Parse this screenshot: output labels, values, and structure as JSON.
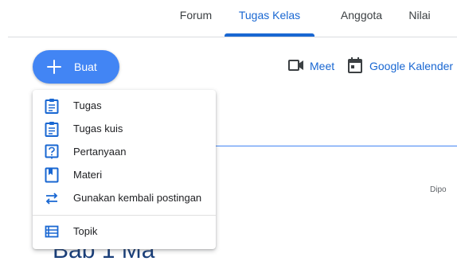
{
  "tabs": [
    {
      "label": "Forum",
      "active": false
    },
    {
      "label": "Tugas Kelas",
      "active": true
    },
    {
      "label": "Anggota",
      "active": false
    },
    {
      "label": "Nilai",
      "active": false
    }
  ],
  "create_button": {
    "label": "Buat",
    "icon": "plus-icon"
  },
  "toolbar": {
    "meet_label": "Meet",
    "calendar_label": "Google Kalender"
  },
  "menu": {
    "items": [
      {
        "label": "Tugas",
        "icon": "assignment-icon"
      },
      {
        "label": "Tugas kuis",
        "icon": "quiz-assignment-icon"
      },
      {
        "label": "Pertanyaan",
        "icon": "question-icon"
      },
      {
        "label": "Materi",
        "icon": "material-icon"
      },
      {
        "label": "Gunakan kembali postingan",
        "icon": "reuse-post-icon"
      }
    ],
    "topic": {
      "label": "Topik",
      "icon": "topic-icon"
    }
  },
  "background": {
    "partial_label": "Dipo",
    "partial_heading": "Bab 1 Ma"
  },
  "colors": {
    "accent": "#1967d2",
    "button": "#4285f4",
    "text": "#3c4043"
  }
}
